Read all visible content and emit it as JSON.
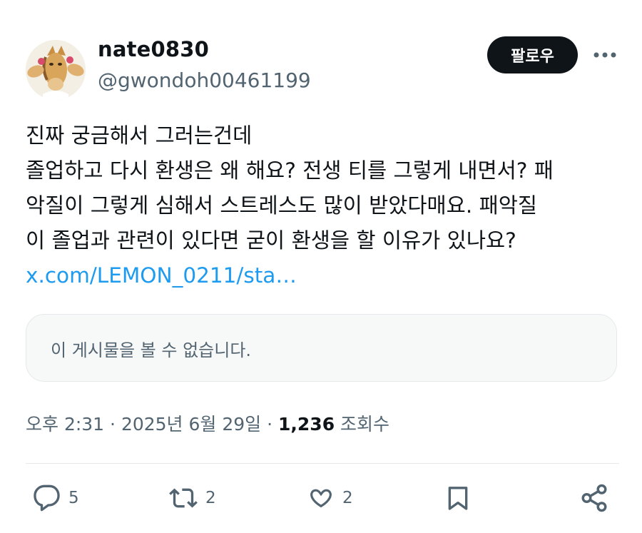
{
  "author": {
    "display_name": "nate0830",
    "handle": "@gwondoh00461199",
    "avatar_icon": "cartoon-horse-avatar"
  },
  "follow_label": "팔로우",
  "more_icon": "more-dots-icon",
  "tweet": {
    "lines": [
      "진짜 궁금해서 그러는건데",
      "졸업하고 다시 환생은 왜 해요? 전생 티를 그렇게 내면서? 패",
      "악질이 그렇게 심해서 스트레스도 많이 받았다매요. 패악질",
      "이 졸업과 관련이 있다면 굳이 환생을 할 이유가 있나요?"
    ],
    "link": "x.com/LEMON_0211/sta…"
  },
  "quoted": {
    "unavailable_text": "이 게시물을 볼 수 없습니다."
  },
  "meta": {
    "time": "오후 2:31",
    "separator": " · ",
    "date": "2025년 6월 29일",
    "views_count": "1,236",
    "views_label": "조회수"
  },
  "actions": {
    "reply_count": "5",
    "retweet_count": "2",
    "like_count": "2"
  },
  "colors": {
    "text": "#0f1419",
    "secondary": "#536471",
    "link": "#1d9bf0",
    "follow_bg": "#0f1419",
    "card_bg": "#f7f9f9",
    "border": "#e6e9ec"
  }
}
